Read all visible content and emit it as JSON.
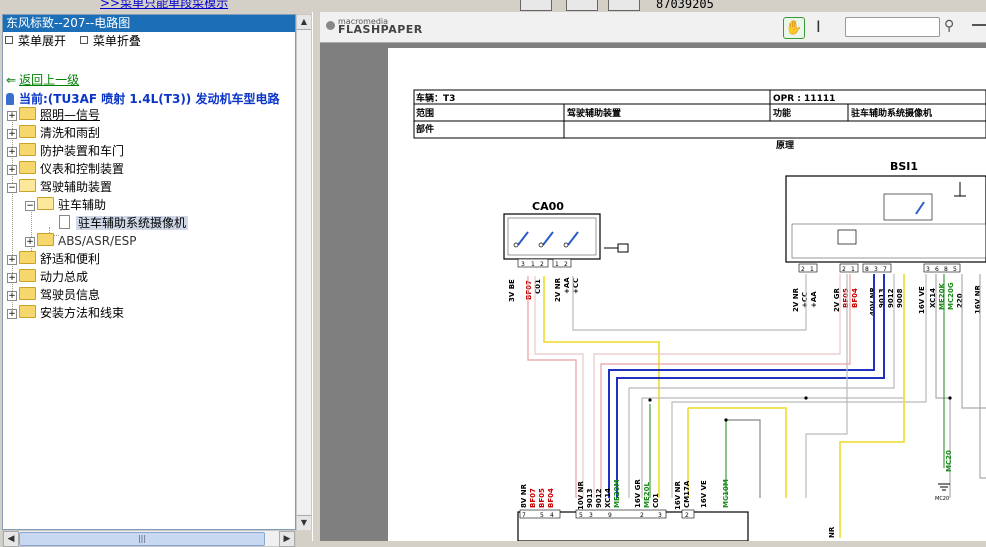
{
  "top": {
    "link_text": ">>菜单只能单段菜模示",
    "number_readout": "87039205"
  },
  "tree": {
    "title": "东风标致--207--电路图",
    "expand_all": "菜单展开",
    "collapse_all": "菜单折叠",
    "back": "返回上一级",
    "current": "当前:(TU3AF 喷射  1.4L(T3)) 发动机车型电路",
    "items": [
      {
        "label": "照明—信号"
      },
      {
        "label": "清洗和雨刮"
      },
      {
        "label": "防护装置和车门"
      },
      {
        "label": "仪表和控制装置"
      },
      {
        "label": "驾驶辅助装置"
      },
      {
        "label": "驻车辅助"
      },
      {
        "label": "驻车辅助系统摄像机"
      },
      {
        "label": "ABS/ASR/ESP"
      },
      {
        "label": "舒适和便利"
      },
      {
        "label": "动力总成"
      },
      {
        "label": "驾驶员信息"
      },
      {
        "label": "安装方法和线束"
      }
    ]
  },
  "viewer": {
    "brand_small": "macromedia",
    "brand_big": "FLASHPAPER"
  },
  "diagram": {
    "hdr_vehicle": "车辆：T3",
    "hdr_opr": "OPR : 11111",
    "hdr_scope_label": "范围",
    "hdr_scope_value": "驾驶辅助装置",
    "hdr_function_label": "功能",
    "hdr_function_value": "驻车辅助系统摄像机",
    "hdr_part_label": "部件",
    "section": "原理",
    "ca00": "CA00",
    "bsi1": "BSI1",
    "ca00_pins": [
      "3",
      "1",
      "2",
      "1",
      "2"
    ],
    "ca00_wires": [
      "3V BE",
      "C01",
      "BF07",
      "2V NR",
      "+AA",
      "+CC"
    ],
    "bsi_wires": [
      "2V NR",
      "+CC",
      "+AA",
      "2V GR",
      "BF05",
      "BF04",
      "40V NR",
      "9013",
      "9012",
      "9008",
      "16V VE",
      "XC14",
      "ME20K",
      "MC20G",
      "220",
      "16V NR"
    ],
    "bsi_pins": [
      "2",
      "1",
      "2",
      "1",
      "8",
      "3",
      "7",
      "3",
      "6",
      "8",
      "5"
    ],
    "bottom_labels": [
      "8V NR",
      "BF07",
      "BF05",
      "BF04",
      "10V NR",
      "9013",
      "9012",
      "XC14",
      "ME20M",
      "16V GR",
      "ME20L",
      "C01",
      "16V NR",
      "CM17A",
      "16V VE",
      "MC10M",
      "MC20",
      "NR",
      "MC20"
    ],
    "bottom_pins": [
      "7",
      "5",
      "4",
      "5",
      "3",
      "9",
      "2",
      "3",
      "2"
    ]
  }
}
